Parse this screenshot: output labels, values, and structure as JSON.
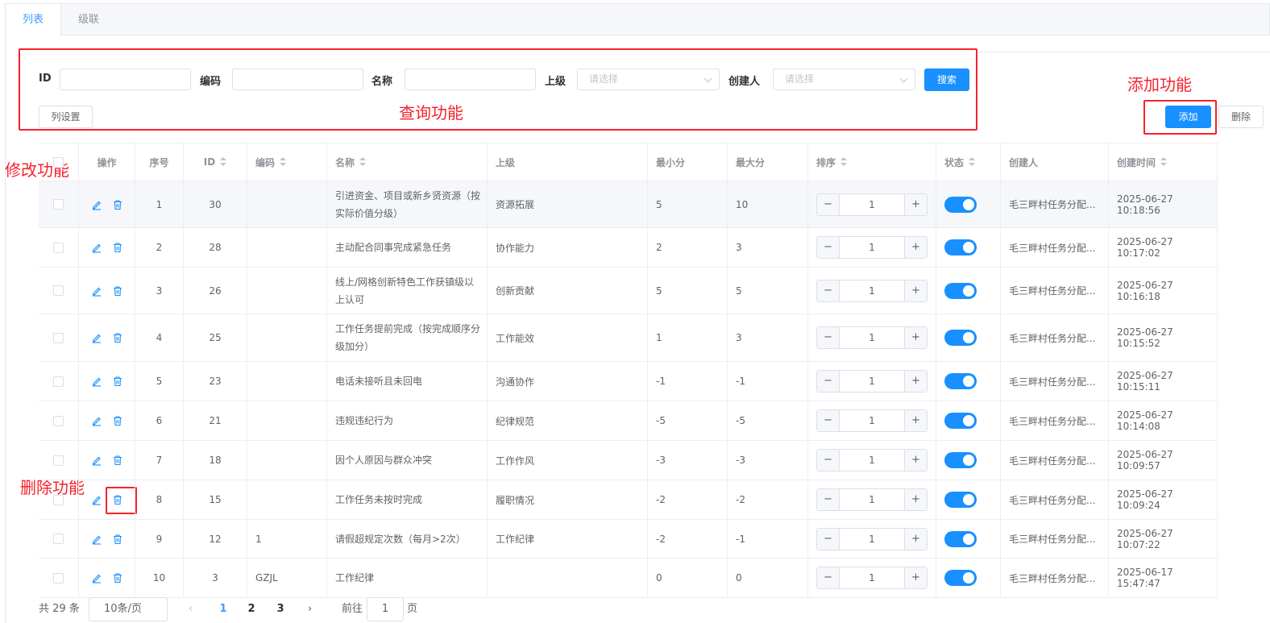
{
  "tabs": [
    "列表",
    "级联"
  ],
  "filters": {
    "id_label": "ID",
    "code_label": "编码",
    "name_label": "名称",
    "parent_label": "上级",
    "parent_placeholder": "请选择",
    "creator_label": "创建人",
    "creator_placeholder": "请选择",
    "search_button": "搜索",
    "columns_button": "列设置"
  },
  "toolbar": {
    "add_button": "添加",
    "delete_button": "删除"
  },
  "annotations": {
    "query": "查询功能",
    "add": "添加功能",
    "edit": "修改功能",
    "delete": "删除功能"
  },
  "colors": {
    "primary": "#1890ff",
    "annotation": "#f5222d"
  },
  "table": {
    "headers": [
      "操作",
      "序号",
      "ID",
      "编码",
      "名称",
      "上级",
      "最小分",
      "最大分",
      "排序",
      "状态",
      "创建人",
      "创建时间"
    ],
    "rows": [
      {
        "no": "1",
        "id": "30",
        "code": "",
        "name": "引进资金、项目或新乡贤资源（按实际价值分级）",
        "parent": "资源拓展",
        "min": "5",
        "max": "10",
        "sort": "1",
        "status": true,
        "creator": "毛三畔村任务分配...",
        "created": "2025-06-27 10:18:56"
      },
      {
        "no": "2",
        "id": "28",
        "code": "",
        "name": "主动配合同事完成紧急任务",
        "parent": "协作能力",
        "min": "2",
        "max": "3",
        "sort": "1",
        "status": true,
        "creator": "毛三畔村任务分配...",
        "created": "2025-06-27 10:17:02"
      },
      {
        "no": "3",
        "id": "26",
        "code": "",
        "name": "线上/网格创新特色工作获镇级以上认可",
        "parent": "创新贡献",
        "min": "5",
        "max": "5",
        "sort": "1",
        "status": true,
        "creator": "毛三畔村任务分配...",
        "created": "2025-06-27 10:16:18"
      },
      {
        "no": "4",
        "id": "25",
        "code": "",
        "name": "工作任务提前完成（按完成顺序分级加分）",
        "parent": "工作能效",
        "min": "1",
        "max": "3",
        "sort": "1",
        "status": true,
        "creator": "毛三畔村任务分配...",
        "created": "2025-06-27 10:15:52"
      },
      {
        "no": "5",
        "id": "23",
        "code": "",
        "name": "电话未接听且未回电",
        "parent": "沟通协作",
        "min": "-1",
        "max": "-1",
        "sort": "1",
        "status": true,
        "creator": "毛三畔村任务分配...",
        "created": "2025-06-27 10:15:11"
      },
      {
        "no": "6",
        "id": "21",
        "code": "",
        "name": "违规违纪行为",
        "parent": "纪律规范",
        "min": "-5",
        "max": "-5",
        "sort": "1",
        "status": true,
        "creator": "毛三畔村任务分配...",
        "created": "2025-06-27 10:14:08"
      },
      {
        "no": "7",
        "id": "18",
        "code": "",
        "name": "因个人原因与群众冲突",
        "parent": "工作作风",
        "min": "-3",
        "max": "-3",
        "sort": "1",
        "status": true,
        "creator": "毛三畔村任务分配...",
        "created": "2025-06-27 10:09:57"
      },
      {
        "no": "8",
        "id": "15",
        "code": "",
        "name": "工作任务未按时完成",
        "parent": "履职情况",
        "min": "-2",
        "max": "-2",
        "sort": "1",
        "status": true,
        "creator": "毛三畔村任务分配...",
        "created": "2025-06-27 10:09:24"
      },
      {
        "no": "9",
        "id": "12",
        "code": "1",
        "name": "请假超规定次数（每月>2次）",
        "parent": "工作纪律",
        "min": "-2",
        "max": "-1",
        "sort": "1",
        "status": true,
        "creator": "毛三畔村任务分配...",
        "created": "2025-06-27 10:07:22"
      },
      {
        "no": "10",
        "id": "3",
        "code": "GZJL",
        "name": "工作纪律",
        "parent": "",
        "min": "0",
        "max": "0",
        "sort": "1",
        "status": true,
        "creator": "毛三畔村任务分配...",
        "created": "2025-06-17 15:47:47"
      }
    ]
  },
  "pagination": {
    "total": "共 29 条",
    "page_size": "10条/页",
    "pages": [
      "1",
      "2",
      "3"
    ],
    "current": "1",
    "goto_label": "前往",
    "goto_value": "1",
    "page_suffix": "页"
  }
}
